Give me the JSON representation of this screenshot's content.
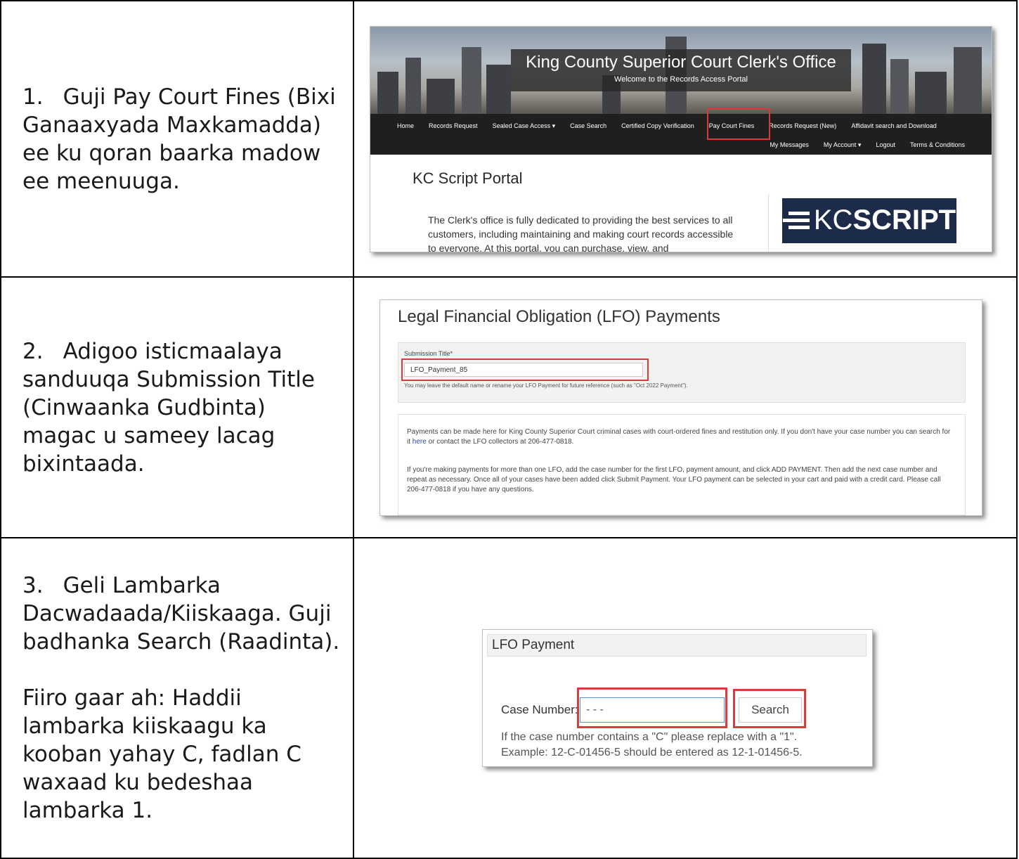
{
  "steps": [
    {
      "number": "1.",
      "text": "Guji Pay Court Fines (Bixi Ganaaxyada Maxkamadda) ee ku qoran baarka madow ee meenuuga."
    },
    {
      "number": "2.",
      "text": "Adigoo isticmaalaya sanduuqa Submission Title (Cinwaanka Gudbinta) magac u sameey lacag bixintaada."
    },
    {
      "number": "3.",
      "text": "Geli Lambarka Dacwadaada/Kiiskaaga. Guji badhanka Search (Raadinta).",
      "note": "Fiiro gaar ah: Haddii lambarka kiiskaagu ka kooban yahay C, fadlan C waxaad ku bedeshaa lambarka 1."
    }
  ],
  "portal": {
    "title": "King County Superior Court Clerk's Office",
    "subtitle": "Welcome to the Records Access Portal",
    "nav_row1": [
      "Home",
      "Records Request",
      "Sealed Case Access ▾",
      "Case Search",
      "Certified Copy Verification",
      "Pay Court Fines",
      "Records Request (New)",
      "Affidavit search and Download"
    ],
    "nav_row2": [
      "My Messages",
      "My Account ▾",
      "Logout",
      "Terms & Conditions"
    ],
    "page_title": "KC Script Portal",
    "body_text": "The Clerk's office is fully dedicated to providing the best services to all customers, including maintaining and making court records accessible to everyone. At this portal, you can purchase, view, and",
    "logo_kc": "KC",
    "logo_script": "SCRIPT"
  },
  "lfo_form": {
    "title": "Legal Financial Obligation (LFO) Payments",
    "submission_label": "Submission Title*",
    "submission_value": "LFO_Payment_85",
    "submission_help": "You may leave the default name or rename your LFO Payment for future reference (such as \"Oct 2022 Payment\").",
    "info_p1_a": "Payments can be made here for King County Superior Court criminal cases with court-ordered fines and restitution only. If you don't have your case number you can search for it ",
    "info_p1_link": "here",
    "info_p1_b": " or contact the LFO collectors at 206-477-0818.",
    "info_p2": "If you're making payments for more than one LFO, add the case number for the first LFO, payment amount, and click ADD PAYMENT. Then add the next case number and repeat as necessary. Once all of your cases have been added click Submit Payment. Your LFO payment can be selected in your cart and paid with a credit card. Please call 206-477-0818 if you have any questions."
  },
  "lfo_payment": {
    "title": "LFO Payment",
    "case_label": "Case Number:",
    "case_value": "- -   -",
    "search_label": "Search",
    "note_line1": "If the case number contains a \"C\" please replace with a \"1\".",
    "note_line2": "Example: 12-C-01456-5 should be entered as 12-1-01456-5."
  },
  "colors": {
    "highlight": "#d93a3a",
    "navbar": "#1f1f1f",
    "logo_bg": "#1d2b4a"
  }
}
